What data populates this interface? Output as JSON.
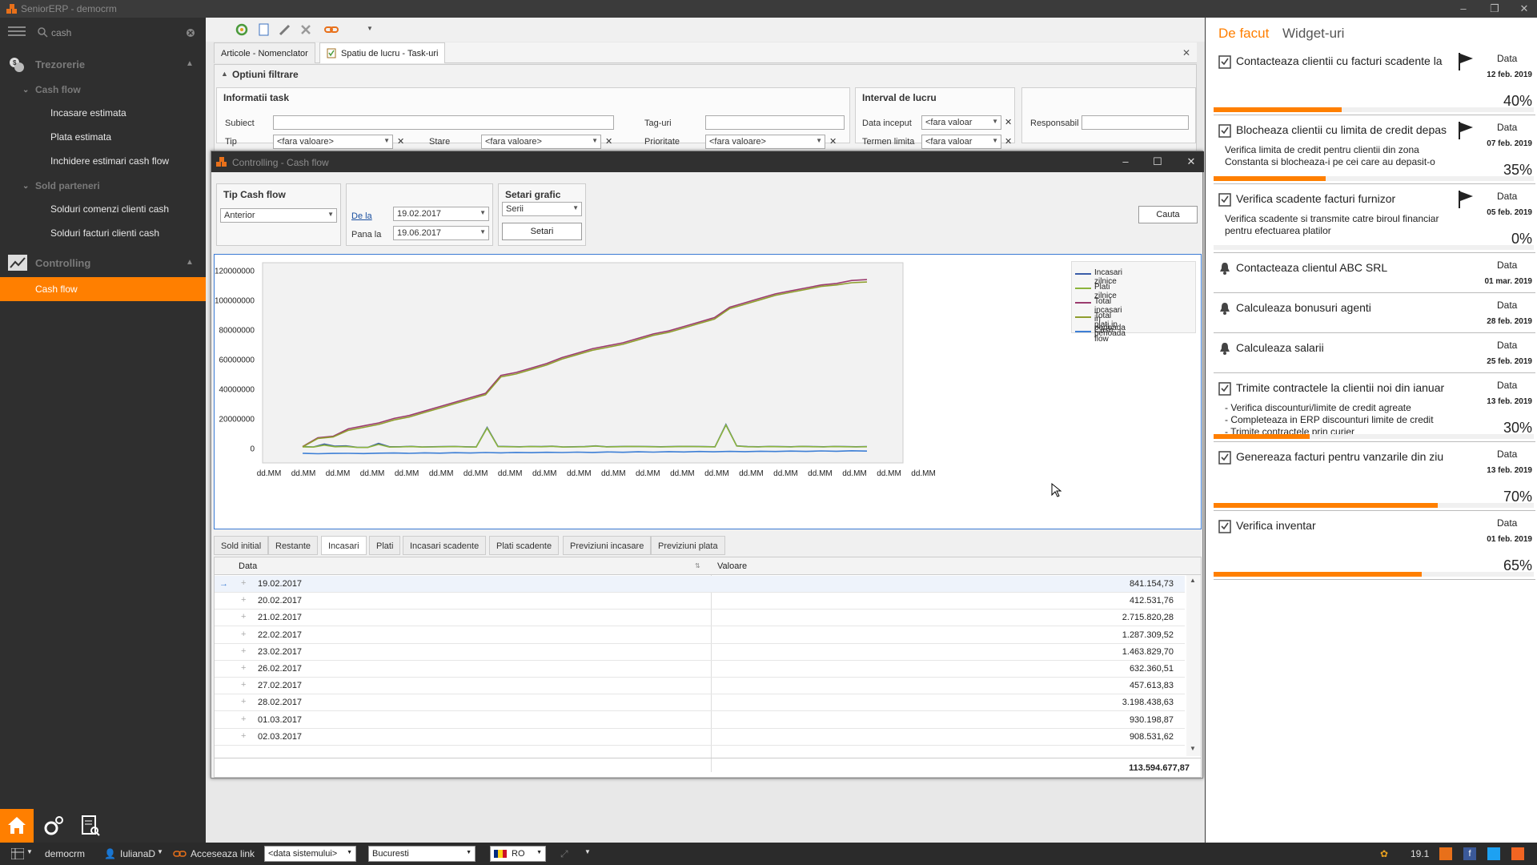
{
  "app": {
    "title": "SeniorERP - democrm"
  },
  "sidebar": {
    "search_value": "cash",
    "groups": [
      {
        "label": "Trezorerie"
      },
      {
        "label": "Controlling"
      }
    ],
    "subgroups": [
      {
        "label": "Cash flow"
      },
      {
        "label": "Sold parteneri"
      }
    ],
    "items": [
      {
        "label": "Incasare estimata"
      },
      {
        "label": "Plata estimata"
      },
      {
        "label": "Inchidere estimari cash flow"
      },
      {
        "label": "Solduri comenzi clienti cash"
      },
      {
        "label": "Solduri facturi clienti cash"
      },
      {
        "label": "Cash flow"
      }
    ]
  },
  "main": {
    "tabs": [
      {
        "label": "Articole - Nomenclator"
      },
      {
        "label": "Spatiu de lucru - Task-uri"
      }
    ],
    "filter": {
      "header": "Optiuni filtrare",
      "task_info": "Informatii task",
      "interval": "Interval de lucru",
      "subiect": "Subiect",
      "tip": "Tip",
      "tip_value": "<fara valoare>",
      "stare": "Stare",
      "stare_value": "<fara valoare>",
      "taguri": "Tag-uri",
      "prioritate": "Prioritate",
      "prioritate_value": "<fara valoare>",
      "data_inceput": "Data inceput",
      "data_inceput_value": "<fara valoar",
      "termen": "Termen limita",
      "termen_value": "<fara valoar",
      "responsabil": "Responsabil"
    }
  },
  "cashflow": {
    "title": "Controlling - Cash flow",
    "tip_label": "Tip Cash flow",
    "tip_value": "Anterior",
    "de_la": "De la",
    "de_la_value": "19.02.2017",
    "pana_la": "Pana la",
    "pana_la_value": "19.06.2017",
    "setari_label": "Setari grafic",
    "serii_value": "Serii",
    "setari_btn": "Setari",
    "cauta_btn": "Cauta",
    "bottom_tabs": [
      "Sold initial",
      "Restante",
      "Incasari",
      "Plati",
      "Incasari scadente",
      "Plati scadente",
      "Previziuni incasare",
      "Previziuni plata"
    ],
    "grid_headers": {
      "data": "Data",
      "valoare": "Valoare"
    },
    "rows": [
      {
        "data": "19.02.2017",
        "valoare": "841.154,73"
      },
      {
        "data": "20.02.2017",
        "valoare": "412.531,76"
      },
      {
        "data": "21.02.2017",
        "valoare": "2.715.820,28"
      },
      {
        "data": "22.02.2017",
        "valoare": "1.287.309,52"
      },
      {
        "data": "23.02.2017",
        "valoare": "1.463.829,70"
      },
      {
        "data": "26.02.2017",
        "valoare": "632.360,51"
      },
      {
        "data": "27.02.2017",
        "valoare": "457.613,83"
      },
      {
        "data": "28.02.2017",
        "valoare": "3.198.438,63"
      },
      {
        "data": "01.03.2017",
        "valoare": "930.198,87"
      },
      {
        "data": "02.03.2017",
        "valoare": "908.531,62"
      }
    ],
    "total": "113.594.677,87"
  },
  "chart_data": {
    "type": "line",
    "y_ticks": [
      "120000000",
      "100000000",
      "80000000",
      "60000000",
      "40000000",
      "20000000",
      "0"
    ],
    "ylim": [
      -10000000,
      125000000
    ],
    "x_tick_label": "dd.MM",
    "x_tick_count": 20,
    "series": [
      {
        "name": "Incasari zilnice",
        "color": "#3a5da8",
        "values": [
          1000000,
          800000,
          2700000,
          1300000,
          1500000,
          600000,
          500000,
          3200000,
          900000,
          900000,
          1200000,
          800000,
          900000,
          1000000,
          1100000,
          900000,
          800000,
          14000000,
          1200000,
          1000000,
          900000,
          1100000,
          1000000,
          1300000,
          800000,
          900000,
          1000000,
          1500000,
          900000,
          1000000,
          1200000,
          1100000,
          1000000,
          900000,
          1000000,
          1200000,
          1100000,
          1000000,
          900000,
          16000000,
          1500000,
          1000000,
          900000,
          1100000,
          1000000,
          900000,
          1200000,
          1000000,
          900000,
          1100000,
          1000000,
          900000,
          1000000
        ]
      },
      {
        "name": "Plati zilnice",
        "color": "#8cb43c",
        "values": [
          800000,
          700000,
          2000000,
          900000,
          1100000,
          500000,
          400000,
          2500000,
          700000,
          800000,
          1000000,
          700000,
          800000,
          900000,
          1000000,
          800000,
          700000,
          13500000,
          1000000,
          900000,
          800000,
          1000000,
          900000,
          1200000,
          700000,
          800000,
          900000,
          1400000,
          800000,
          900000,
          1100000,
          1000000,
          900000,
          800000,
          900000,
          1100000,
          1000000,
          900000,
          800000,
          15500000,
          1400000,
          900000,
          800000,
          1000000,
          900000,
          800000,
          1100000,
          900000,
          800000,
          1000000,
          900000,
          800000,
          900000
        ]
      },
      {
        "name": "Total incasari in perioada",
        "color": "#9b3b6e",
        "values": [
          1000000,
          7000000,
          8000000,
          13000000,
          15000000,
          17000000,
          20000000,
          22000000,
          25000000,
          28000000,
          31000000,
          34000000,
          37000000,
          49000000,
          51000000,
          54000000,
          57000000,
          61000000,
          64000000,
          67000000,
          69000000,
          71000000,
          74000000,
          77000000,
          79000000,
          82000000,
          85000000,
          88000000,
          95000000,
          98000000,
          101000000,
          104000000,
          106000000,
          108000000,
          110000000,
          111000000,
          113000000,
          113600000
        ]
      },
      {
        "name": "Total plati in perioada",
        "color": "#8f9e2e",
        "values": [
          800000,
          6500000,
          7500000,
          12000000,
          14000000,
          16000000,
          19000000,
          21000000,
          24000000,
          27000000,
          30000000,
          33000000,
          36000000,
          48000000,
          50000000,
          53000000,
          56000000,
          60000000,
          63000000,
          66000000,
          68000000,
          70000000,
          73000000,
          76000000,
          78000000,
          81000000,
          84000000,
          87000000,
          94000000,
          97000000,
          100000000,
          103000000,
          105000000,
          107000000,
          109000000,
          110000000,
          111500000,
          112000000
        ]
      },
      {
        "name": "Cash flow",
        "color": "#3d7fd6",
        "values": [
          -3500000,
          -3800000,
          -3600000,
          -3500000,
          -3700000,
          -3400000,
          -3300000,
          -3500000,
          -3200000,
          -3400000,
          -3100000,
          -3300000,
          -3000000,
          -3200000,
          -2900000,
          -3100000,
          -2800000,
          -3000000,
          -2700000,
          -2900000,
          -2600000,
          -2800000,
          -2500000,
          -2700000,
          -2400000,
          -2600000,
          -2300000,
          -2500000,
          -2200000,
          -2400000,
          -2100000,
          -2300000,
          -2000000,
          -2200000,
          -1900000,
          -2100000,
          -1800000,
          -2000000
        ]
      }
    ]
  },
  "right_panel": {
    "tab_active": "De facut",
    "tab_other": "Widget-uri",
    "tasks": [
      {
        "title": "Contacteaza clientii cu facturi scadente la",
        "date_label": "Data",
        "date": "12 feb. 2019",
        "percent": "40%",
        "progress": 0.4,
        "desc": ""
      },
      {
        "title": "Blocheaza clientii cu limita de credit depas",
        "date_label": "Data",
        "date": "07 feb. 2019",
        "percent": "35%",
        "progress": 0.35,
        "desc": "Verifica limita de credit pentru clientii din zona Constanta si blocheaza-i pe cei care au depasit-o"
      },
      {
        "title": "Verifica scadente facturi furnizor",
        "date_label": "Data",
        "date": "05 feb. 2019",
        "percent": "0%",
        "progress": 0.0,
        "desc": "Verifica scadente si transmite catre biroul financiar pentru efectuarea platilor"
      },
      {
        "title": "Contacteaza clientul ABC SRL",
        "date_label": "Data",
        "date": "01 mar. 2019",
        "percent": "",
        "desc": ""
      },
      {
        "title": "Calculeaza bonusuri agenti",
        "date_label": "Data",
        "date": "28 feb. 2019",
        "percent": "",
        "desc": ""
      },
      {
        "title": "Calculeaza salarii",
        "date_label": "Data",
        "date": "25 feb. 2019",
        "percent": "",
        "desc": ""
      },
      {
        "title": "Trimite contractele la clientii noi din ianuar",
        "date_label": "Data",
        "date": "13 feb. 2019",
        "percent": "30%",
        "progress": 0.3,
        "desc": "- Verifica discounturi/limite de credit agreate\n- Completeaza in ERP discounturi  limite de credit\n- Trimite contractele prin curier"
      },
      {
        "title": "Genereaza facturi pentru vanzarile din ziu",
        "date_label": "Data",
        "date": "13 feb. 2019",
        "percent": "70%",
        "progress": 0.7,
        "desc": ""
      },
      {
        "title": "Verifica inventar",
        "date_label": "Data",
        "date": "01 feb. 2019",
        "percent": "65%",
        "progress": 0.65,
        "desc": ""
      }
    ]
  },
  "statusbar": {
    "company": "democrm",
    "user": "IulianaD",
    "link": "Acceseaza link",
    "date_value": "<data sistemului>",
    "city_value": "Bucuresti",
    "lang": "RO",
    "version": "19.1"
  }
}
